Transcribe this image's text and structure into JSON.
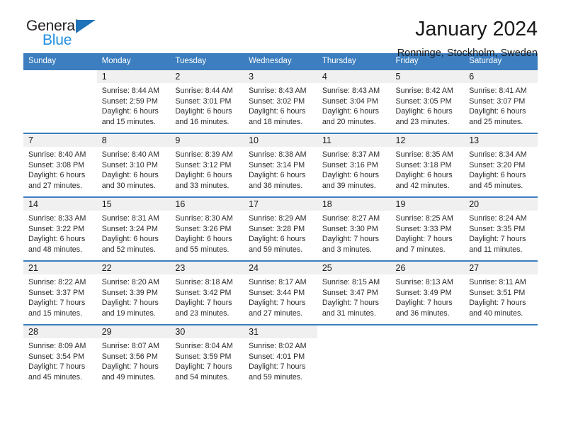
{
  "brand": {
    "name_top": "General",
    "name_bottom": "Blue",
    "triangle_color": "#1f73b8",
    "blue_text_color": "#1f8fe0"
  },
  "header": {
    "title": "January 2024",
    "subtitle": "Ronninge, Stockholm, Sweden"
  },
  "colors": {
    "header_band": "#3c7ebf",
    "row_separator": "#3c7ebf",
    "daynum_band": "#f0f0f0",
    "text": "#1a1a1a"
  },
  "weekday_headers": [
    "Sunday",
    "Monday",
    "Tuesday",
    "Wednesday",
    "Thursday",
    "Friday",
    "Saturday"
  ],
  "weeks": [
    [
      {
        "day": "",
        "lines": [
          "",
          "",
          "",
          ""
        ]
      },
      {
        "day": "1",
        "lines": [
          "Sunrise: 8:44 AM",
          "Sunset: 2:59 PM",
          "Daylight: 6 hours",
          "and 15 minutes."
        ]
      },
      {
        "day": "2",
        "lines": [
          "Sunrise: 8:44 AM",
          "Sunset: 3:01 PM",
          "Daylight: 6 hours",
          "and 16 minutes."
        ]
      },
      {
        "day": "3",
        "lines": [
          "Sunrise: 8:43 AM",
          "Sunset: 3:02 PM",
          "Daylight: 6 hours",
          "and 18 minutes."
        ]
      },
      {
        "day": "4",
        "lines": [
          "Sunrise: 8:43 AM",
          "Sunset: 3:04 PM",
          "Daylight: 6 hours",
          "and 20 minutes."
        ]
      },
      {
        "day": "5",
        "lines": [
          "Sunrise: 8:42 AM",
          "Sunset: 3:05 PM",
          "Daylight: 6 hours",
          "and 23 minutes."
        ]
      },
      {
        "day": "6",
        "lines": [
          "Sunrise: 8:41 AM",
          "Sunset: 3:07 PM",
          "Daylight: 6 hours",
          "and 25 minutes."
        ]
      }
    ],
    [
      {
        "day": "7",
        "lines": [
          "Sunrise: 8:40 AM",
          "Sunset: 3:08 PM",
          "Daylight: 6 hours",
          "and 27 minutes."
        ]
      },
      {
        "day": "8",
        "lines": [
          "Sunrise: 8:40 AM",
          "Sunset: 3:10 PM",
          "Daylight: 6 hours",
          "and 30 minutes."
        ]
      },
      {
        "day": "9",
        "lines": [
          "Sunrise: 8:39 AM",
          "Sunset: 3:12 PM",
          "Daylight: 6 hours",
          "and 33 minutes."
        ]
      },
      {
        "day": "10",
        "lines": [
          "Sunrise: 8:38 AM",
          "Sunset: 3:14 PM",
          "Daylight: 6 hours",
          "and 36 minutes."
        ]
      },
      {
        "day": "11",
        "lines": [
          "Sunrise: 8:37 AM",
          "Sunset: 3:16 PM",
          "Daylight: 6 hours",
          "and 39 minutes."
        ]
      },
      {
        "day": "12",
        "lines": [
          "Sunrise: 8:35 AM",
          "Sunset: 3:18 PM",
          "Daylight: 6 hours",
          "and 42 minutes."
        ]
      },
      {
        "day": "13",
        "lines": [
          "Sunrise: 8:34 AM",
          "Sunset: 3:20 PM",
          "Daylight: 6 hours",
          "and 45 minutes."
        ]
      }
    ],
    [
      {
        "day": "14",
        "lines": [
          "Sunrise: 8:33 AM",
          "Sunset: 3:22 PM",
          "Daylight: 6 hours",
          "and 48 minutes."
        ]
      },
      {
        "day": "15",
        "lines": [
          "Sunrise: 8:31 AM",
          "Sunset: 3:24 PM",
          "Daylight: 6 hours",
          "and 52 minutes."
        ]
      },
      {
        "day": "16",
        "lines": [
          "Sunrise: 8:30 AM",
          "Sunset: 3:26 PM",
          "Daylight: 6 hours",
          "and 55 minutes."
        ]
      },
      {
        "day": "17",
        "lines": [
          "Sunrise: 8:29 AM",
          "Sunset: 3:28 PM",
          "Daylight: 6 hours",
          "and 59 minutes."
        ]
      },
      {
        "day": "18",
        "lines": [
          "Sunrise: 8:27 AM",
          "Sunset: 3:30 PM",
          "Daylight: 7 hours",
          "and 3 minutes."
        ]
      },
      {
        "day": "19",
        "lines": [
          "Sunrise: 8:25 AM",
          "Sunset: 3:33 PM",
          "Daylight: 7 hours",
          "and 7 minutes."
        ]
      },
      {
        "day": "20",
        "lines": [
          "Sunrise: 8:24 AM",
          "Sunset: 3:35 PM",
          "Daylight: 7 hours",
          "and 11 minutes."
        ]
      }
    ],
    [
      {
        "day": "21",
        "lines": [
          "Sunrise: 8:22 AM",
          "Sunset: 3:37 PM",
          "Daylight: 7 hours",
          "and 15 minutes."
        ]
      },
      {
        "day": "22",
        "lines": [
          "Sunrise: 8:20 AM",
          "Sunset: 3:39 PM",
          "Daylight: 7 hours",
          "and 19 minutes."
        ]
      },
      {
        "day": "23",
        "lines": [
          "Sunrise: 8:18 AM",
          "Sunset: 3:42 PM",
          "Daylight: 7 hours",
          "and 23 minutes."
        ]
      },
      {
        "day": "24",
        "lines": [
          "Sunrise: 8:17 AM",
          "Sunset: 3:44 PM",
          "Daylight: 7 hours",
          "and 27 minutes."
        ]
      },
      {
        "day": "25",
        "lines": [
          "Sunrise: 8:15 AM",
          "Sunset: 3:47 PM",
          "Daylight: 7 hours",
          "and 31 minutes."
        ]
      },
      {
        "day": "26",
        "lines": [
          "Sunrise: 8:13 AM",
          "Sunset: 3:49 PM",
          "Daylight: 7 hours",
          "and 36 minutes."
        ]
      },
      {
        "day": "27",
        "lines": [
          "Sunrise: 8:11 AM",
          "Sunset: 3:51 PM",
          "Daylight: 7 hours",
          "and 40 minutes."
        ]
      }
    ],
    [
      {
        "day": "28",
        "lines": [
          "Sunrise: 8:09 AM",
          "Sunset: 3:54 PM",
          "Daylight: 7 hours",
          "and 45 minutes."
        ]
      },
      {
        "day": "29",
        "lines": [
          "Sunrise: 8:07 AM",
          "Sunset: 3:56 PM",
          "Daylight: 7 hours",
          "and 49 minutes."
        ]
      },
      {
        "day": "30",
        "lines": [
          "Sunrise: 8:04 AM",
          "Sunset: 3:59 PM",
          "Daylight: 7 hours",
          "and 54 minutes."
        ]
      },
      {
        "day": "31",
        "lines": [
          "Sunrise: 8:02 AM",
          "Sunset: 4:01 PM",
          "Daylight: 7 hours",
          "and 59 minutes."
        ]
      },
      {
        "day": "",
        "lines": [
          "",
          "",
          "",
          ""
        ]
      },
      {
        "day": "",
        "lines": [
          "",
          "",
          "",
          ""
        ]
      },
      {
        "day": "",
        "lines": [
          "",
          "",
          "",
          ""
        ]
      }
    ]
  ]
}
